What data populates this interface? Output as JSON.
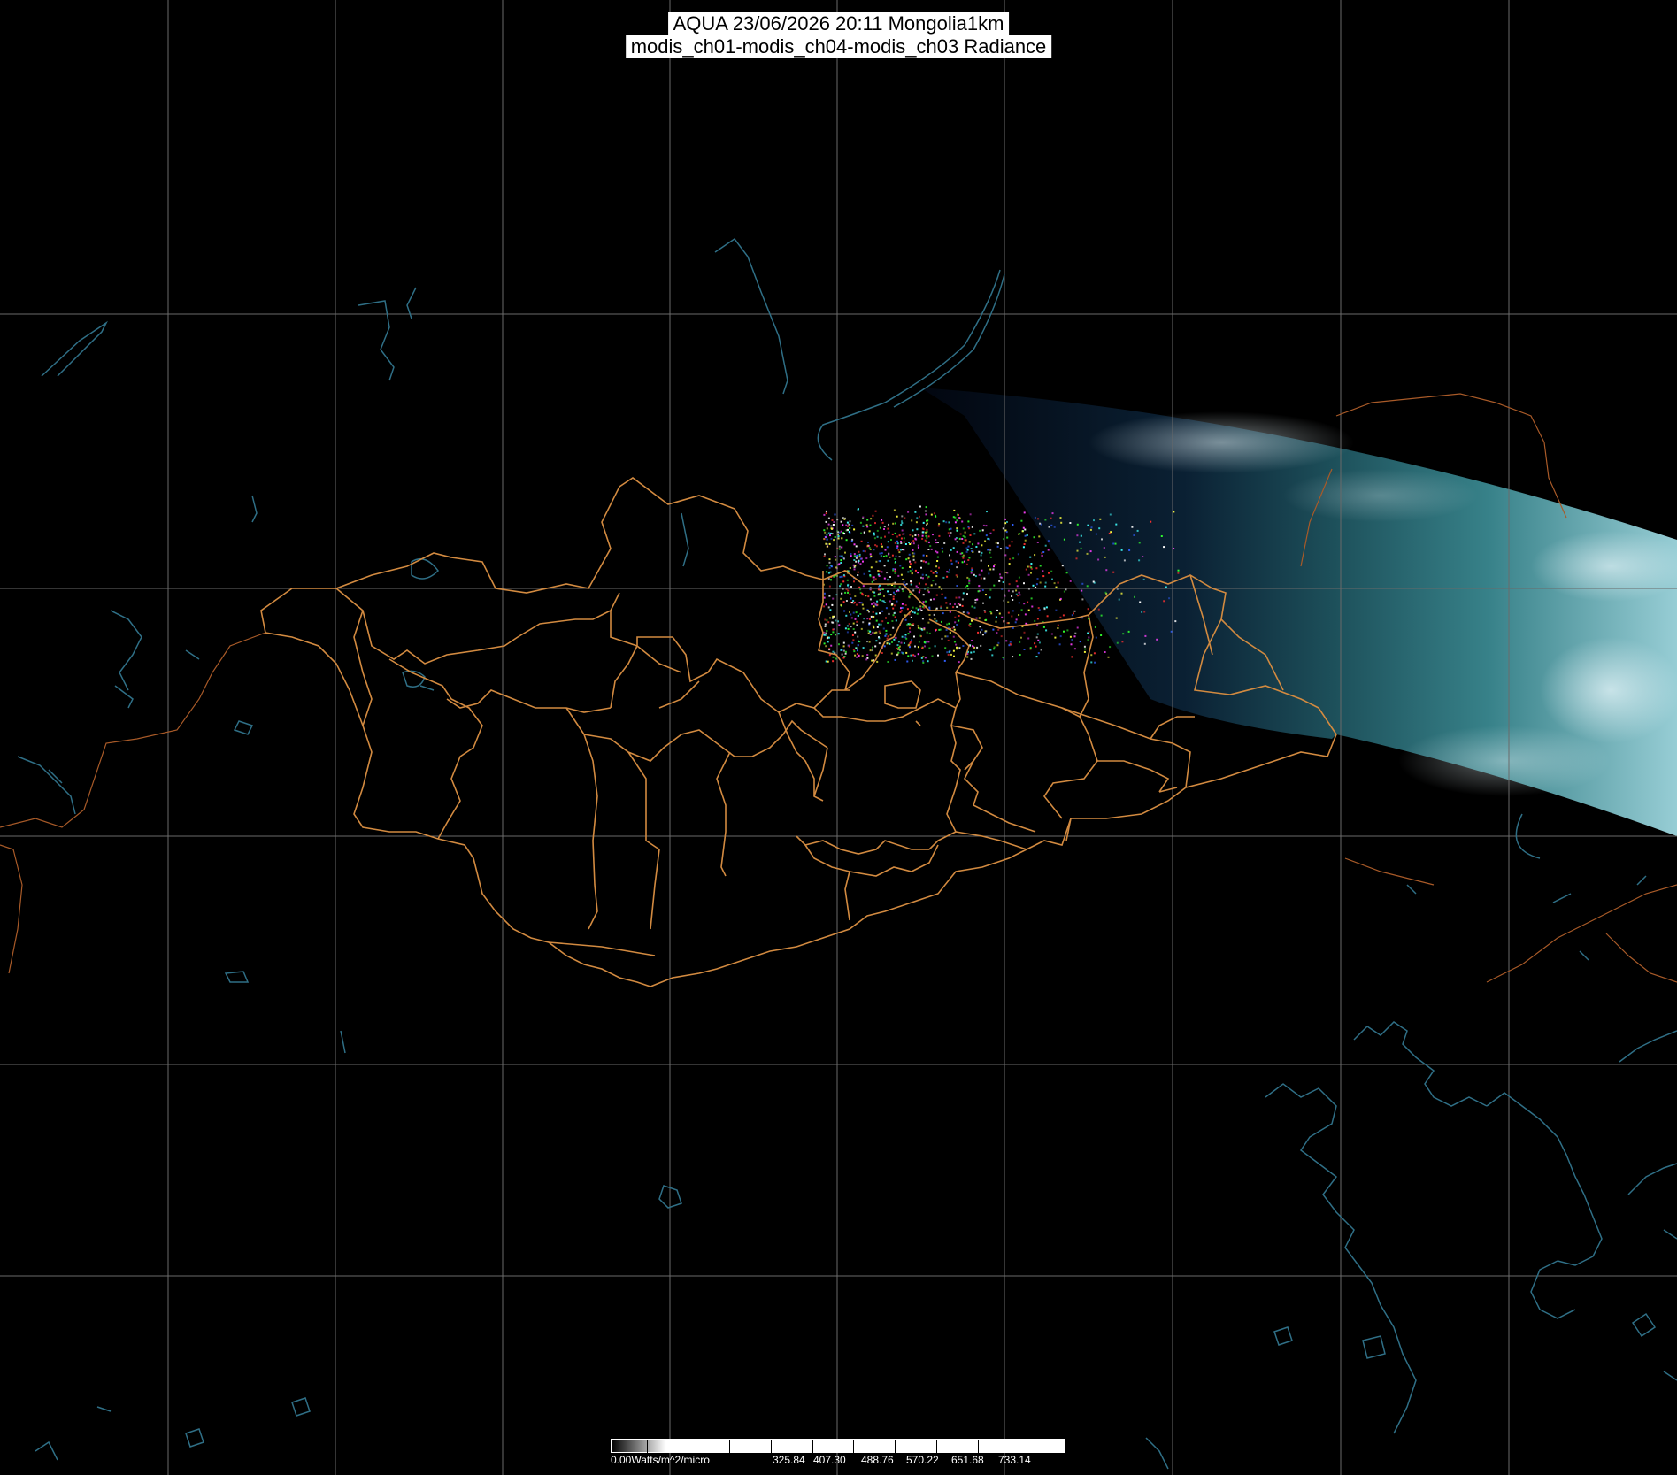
{
  "title": {
    "line1": "AQUA 23/06/2026 20:11 Mongolia1km",
    "line2": "modis_ch01-modis_ch04-modis_ch03 Radiance"
  },
  "colors": {
    "background": "#000000",
    "grid": "#6a6a6a",
    "coastline": "#2f6f86",
    "admin_border": "#d28a40",
    "swath_dark": "#0a1830",
    "swath_mid": "#2a6a74",
    "swath_bright": "#8fd0d8"
  },
  "colorbar": {
    "unit_label": "0.00Watts/m^2/micro",
    "tick_labels": [
      "325.84",
      "407.30",
      "488.76",
      "570.22",
      "651.68",
      "733.14"
    ]
  }
}
